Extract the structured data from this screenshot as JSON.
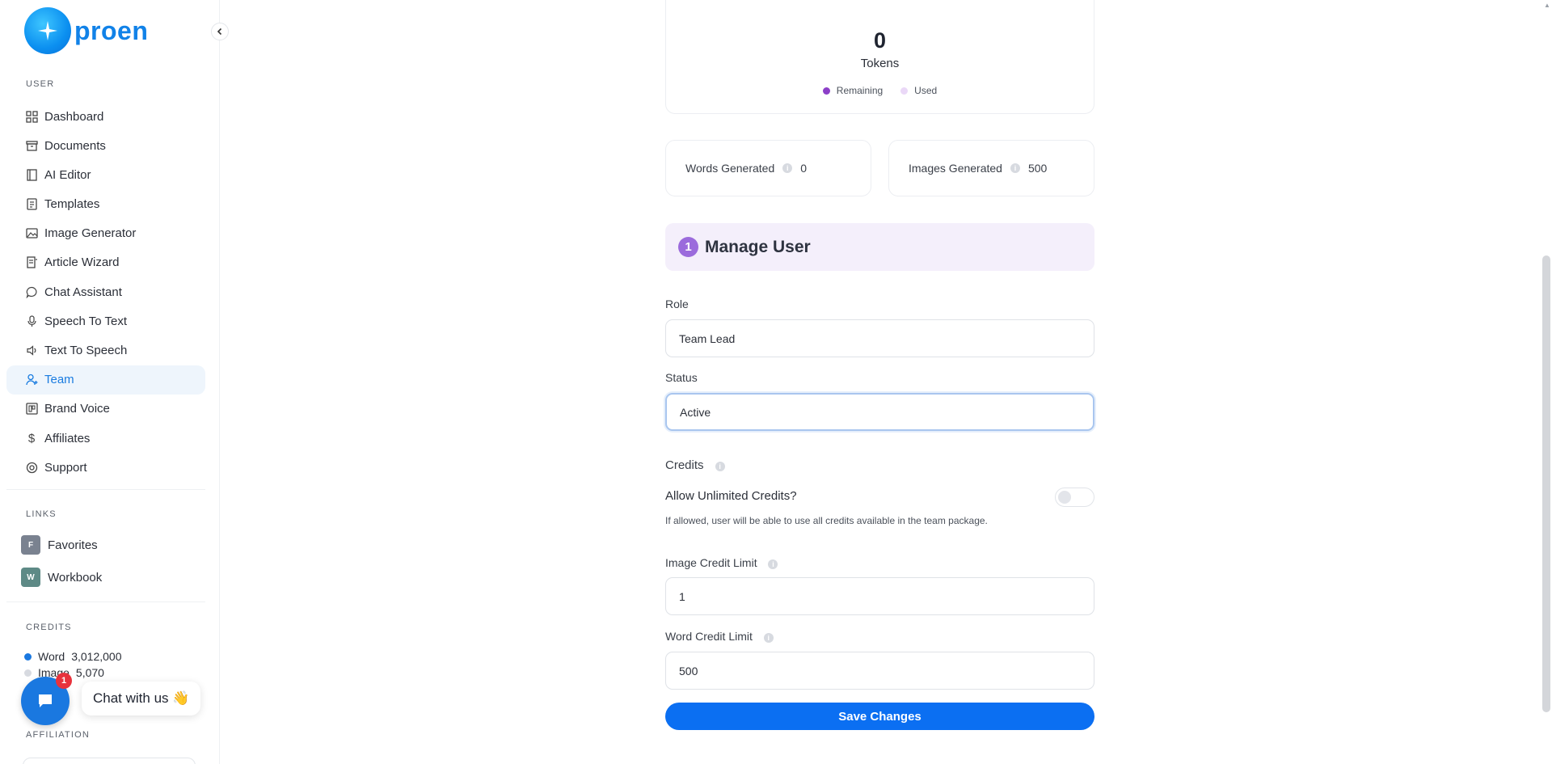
{
  "brand": {
    "name": "proen"
  },
  "sidebar": {
    "user_label": "USER",
    "items": [
      {
        "label": "Dashboard",
        "icon": "grid-icon"
      },
      {
        "label": "Documents",
        "icon": "archive-icon"
      },
      {
        "label": "AI Editor",
        "icon": "notebook-icon"
      },
      {
        "label": "Templates",
        "icon": "file-text-icon"
      },
      {
        "label": "Image Generator",
        "icon": "image-icon"
      },
      {
        "label": "Article Wizard",
        "icon": "article-icon"
      },
      {
        "label": "Chat Assistant",
        "icon": "chat-icon"
      },
      {
        "label": "Speech To Text",
        "icon": "microphone-icon"
      },
      {
        "label": "Text To Speech",
        "icon": "speaker-icon"
      },
      {
        "label": "Team",
        "icon": "user-plus-icon",
        "active": true
      },
      {
        "label": "Brand Voice",
        "icon": "brand-icon"
      },
      {
        "label": "Affiliates",
        "icon": "dollar-icon"
      },
      {
        "label": "Support",
        "icon": "lifebuoy-icon"
      }
    ],
    "links_label": "LINKS",
    "links": [
      {
        "badge": "F",
        "label": "Favorites",
        "color": "#7a8290"
      },
      {
        "badge": "W",
        "label": "Workbook",
        "color": "#5e8a86"
      }
    ],
    "credits_label": "CREDITS",
    "credits": [
      {
        "name": "Word",
        "value": "3,012,000",
        "color": "#1a78e0"
      },
      {
        "name": "Image",
        "value": "5,070",
        "color": "#d7dae0"
      }
    ],
    "affiliation_label": "AFFILIATION"
  },
  "chat": {
    "count": "1",
    "label": "Chat with us 👋"
  },
  "tokens": {
    "value": "0",
    "label": "Tokens",
    "legend": [
      {
        "label": "Remaining",
        "color": "#8c3fc8"
      },
      {
        "label": "Used",
        "color": "#ead8f7"
      }
    ]
  },
  "stats": {
    "words": {
      "label": "Words Generated",
      "value": "0"
    },
    "images": {
      "label": "Images Generated",
      "value": "500"
    }
  },
  "manage": {
    "step": "1",
    "title": "Manage User"
  },
  "form": {
    "role_label": "Role",
    "role_value": "Team Lead",
    "status_label": "Status",
    "status_value": "Active",
    "credits_label": "Credits",
    "unlimited_label": "Allow Unlimited Credits?",
    "unlimited_help": "If allowed, user will be able to use all credits available in the team package.",
    "image_limit_label": "Image Credit Limit",
    "image_limit_value": "1",
    "word_limit_label": "Word Credit Limit",
    "word_limit_value": "500",
    "save_label": "Save Changes"
  }
}
